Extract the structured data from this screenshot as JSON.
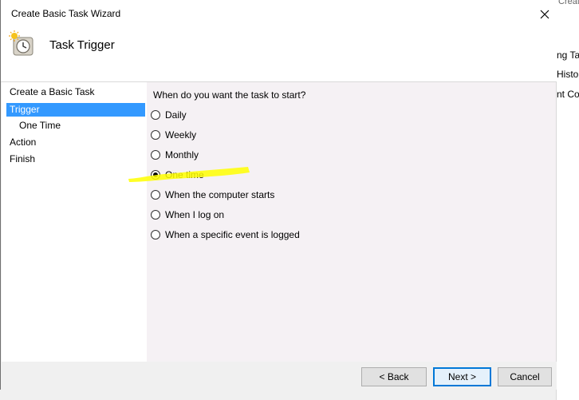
{
  "window": {
    "title": "Create Basic Task Wizard"
  },
  "header": {
    "title": "Task Trigger",
    "icon": "task-clock-icon"
  },
  "sidebar": {
    "steps": [
      {
        "label": "Create a Basic Task",
        "active": false,
        "sub": false
      },
      {
        "label": "Trigger",
        "active": true,
        "sub": false
      },
      {
        "label": "One Time",
        "active": false,
        "sub": true
      },
      {
        "label": "Action",
        "active": false,
        "sub": false
      },
      {
        "label": "Finish",
        "active": false,
        "sub": false
      }
    ]
  },
  "content": {
    "question": "When do you want the task to start?",
    "options": [
      {
        "label": "Daily",
        "checked": false
      },
      {
        "label": "Weekly",
        "checked": false
      },
      {
        "label": "Monthly",
        "checked": false
      },
      {
        "label": "One time",
        "checked": true
      },
      {
        "label": "When the computer starts",
        "checked": false
      },
      {
        "label": "When I log on",
        "checked": false
      },
      {
        "label": "When a specific event is logged",
        "checked": false
      }
    ],
    "highlight_color": "#ffff00"
  },
  "footer": {
    "back_label": "< Back",
    "next_label": "Next >",
    "cancel_label": "Cancel"
  },
  "background_app": {
    "lines": [
      "ng Ta",
      "Histo",
      "nt Co"
    ],
    "top_text": "Create Basic Task..."
  },
  "colors": {
    "selection": "#3399ff",
    "accent": "#0078d7"
  }
}
